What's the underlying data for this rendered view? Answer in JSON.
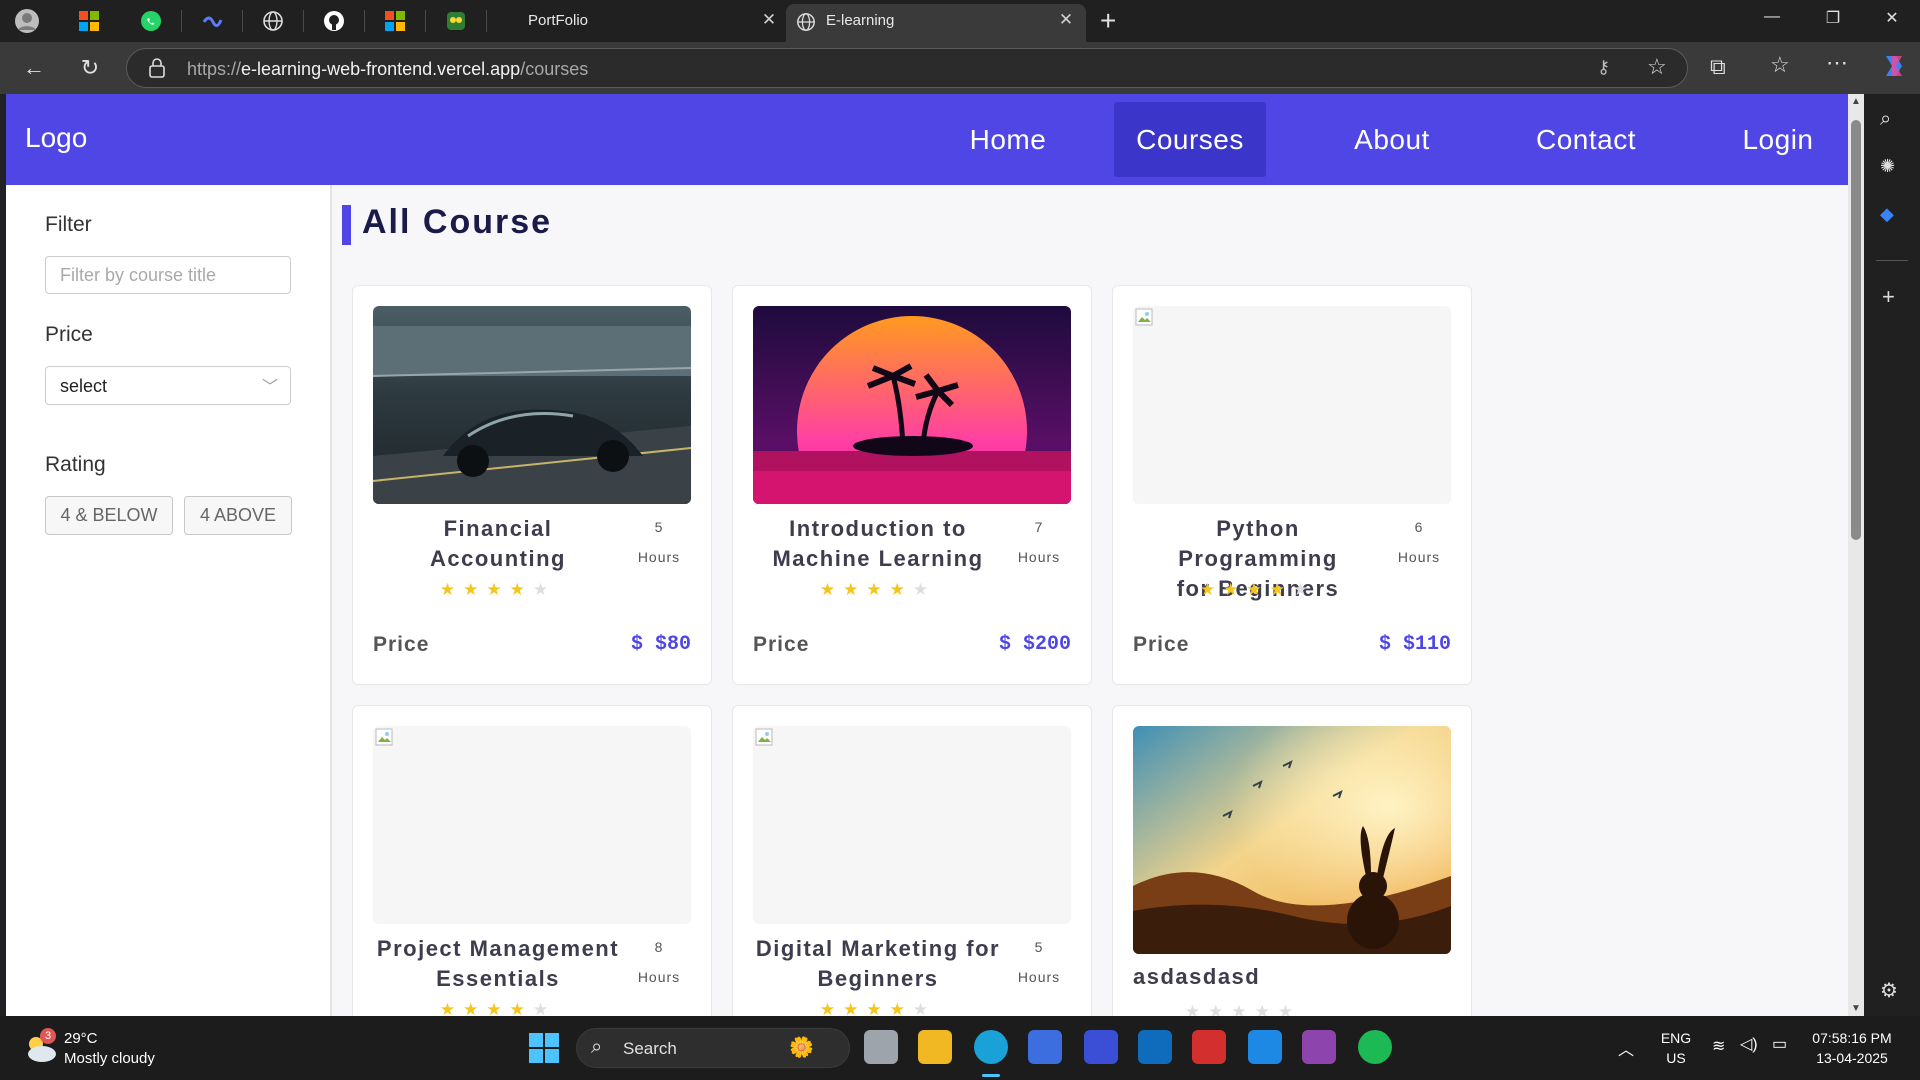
{
  "browser": {
    "tabs": [
      {
        "label": "PortFolio"
      },
      {
        "label": "E-learning"
      }
    ],
    "url_scheme": "https://",
    "url_host": "e-learning-web-frontend.vercel.app",
    "url_path": "/courses"
  },
  "nav": {
    "logo": "Logo",
    "items": [
      {
        "label": "Home"
      },
      {
        "label": "Courses"
      },
      {
        "label": "About"
      },
      {
        "label": "Contact"
      },
      {
        "label": "Login"
      }
    ]
  },
  "sidebar": {
    "filter_label": "Filter",
    "filter_placeholder": "Filter by course title",
    "price_label": "Price",
    "price_select_value": "select",
    "rating_label": "Rating",
    "rating_buttons": [
      "4 & BELOW",
      "4 ABOVE"
    ]
  },
  "main": {
    "heading": "All Course",
    "price_label": "Price",
    "hours_label": "Hours",
    "courses": [
      {
        "title_line1": "Financial",
        "title_line2": "Accounting",
        "hours": "5",
        "rating": 4,
        "price": "$ $80"
      },
      {
        "title_line1": "Introduction to",
        "title_line2": "Machine Learning",
        "hours": "7",
        "rating": 4,
        "price": "$ $200"
      },
      {
        "title_line1": "Python Programming",
        "title_line2": "for Beginners",
        "hours": "6",
        "rating": 4,
        "price": "$ $110"
      },
      {
        "title_line1": "Project Management",
        "title_line2": "Essentials",
        "hours": "8",
        "rating": 4
      },
      {
        "title_line1": "Digital Marketing for",
        "title_line2": "Beginners",
        "hours": "5",
        "rating": 4
      },
      {
        "title_line1": "asdasdasd",
        "title_line2": "",
        "rating": 0
      }
    ]
  },
  "taskbar": {
    "weather_badge": "3",
    "weather_temp": "29°C",
    "weather_desc": "Mostly cloudy",
    "search_label": "Search",
    "lang": "ENG",
    "region": "US",
    "time": "07:58:16 PM",
    "date": "13-04-2025"
  },
  "colors": {
    "brand": "#4f46e5",
    "star": "#f5c518"
  }
}
